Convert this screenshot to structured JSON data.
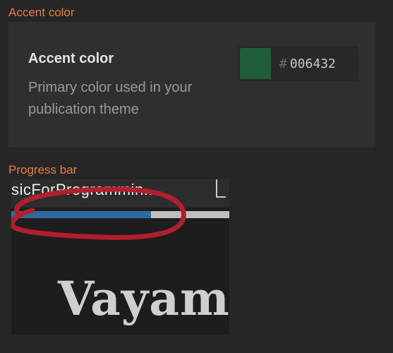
{
  "sections": {
    "accent_label": "Accent color",
    "progress_label": "Progress bar"
  },
  "accent_card": {
    "title": "Accent color",
    "description": "Primary color used in your publication theme",
    "hash": "#",
    "hex_value": "006432",
    "swatch_color": "#1f5c38"
  },
  "embedded_screenshot": {
    "tab_title": "sicForProgrammin...",
    "progress_value": 0.64,
    "heading_text": "Vayam",
    "annotation_color": "#b0202c"
  }
}
